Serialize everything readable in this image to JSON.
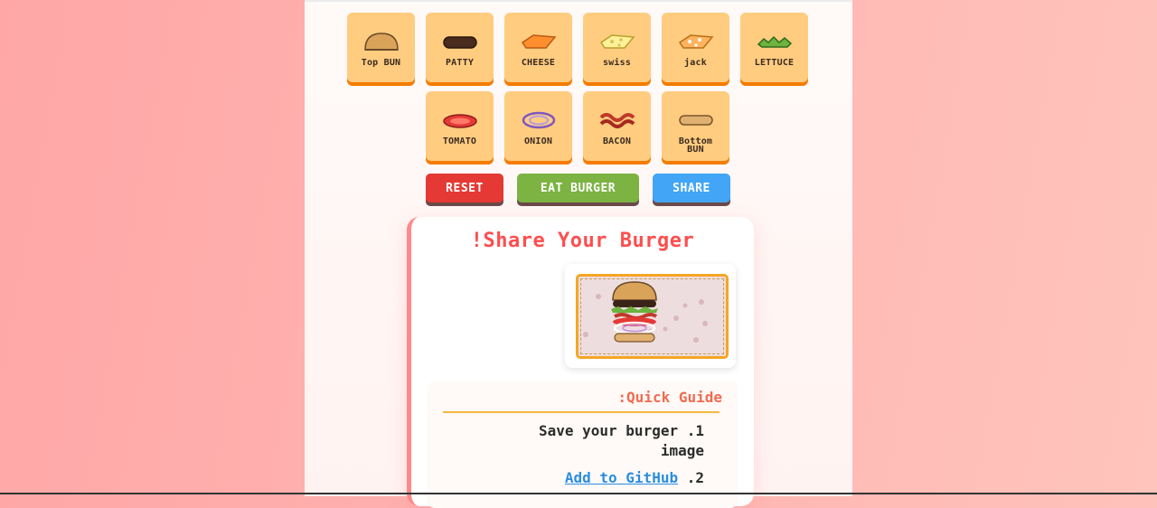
{
  "ingredients": [
    {
      "label": "Top BUN",
      "icon": "top-bun-icon"
    },
    {
      "label": "PATTY",
      "icon": "patty-icon"
    },
    {
      "label": "CHEESE",
      "icon": "cheese-icon"
    },
    {
      "label": "swiss",
      "icon": "swiss-cheese-icon"
    },
    {
      "label": "jack",
      "icon": "jack-cheese-icon"
    },
    {
      "label": "LETTUCE",
      "icon": "lettuce-icon"
    },
    {
      "label": "TOMATO",
      "icon": "tomato-icon"
    },
    {
      "label": "ONION",
      "icon": "onion-icon"
    },
    {
      "label": "BACON",
      "icon": "bacon-icon"
    },
    {
      "label": "Bottom BUN",
      "icon": "bottom-bun-icon"
    }
  ],
  "actions": {
    "reset": {
      "label": "RESET",
      "color": "#e53935"
    },
    "eat": {
      "label": "EAT BURGER",
      "color": "#7cb342"
    },
    "share": {
      "label": "SHARE",
      "color": "#42a5f5"
    }
  },
  "share_card": {
    "title": "!Share Your Burger",
    "guide": {
      "title": ":Quick Guide",
      "step1": "Save your burger .1",
      "step1_cont": "image",
      "step2_link": "Add to GitHub",
      "step2_num": ".2"
    }
  }
}
